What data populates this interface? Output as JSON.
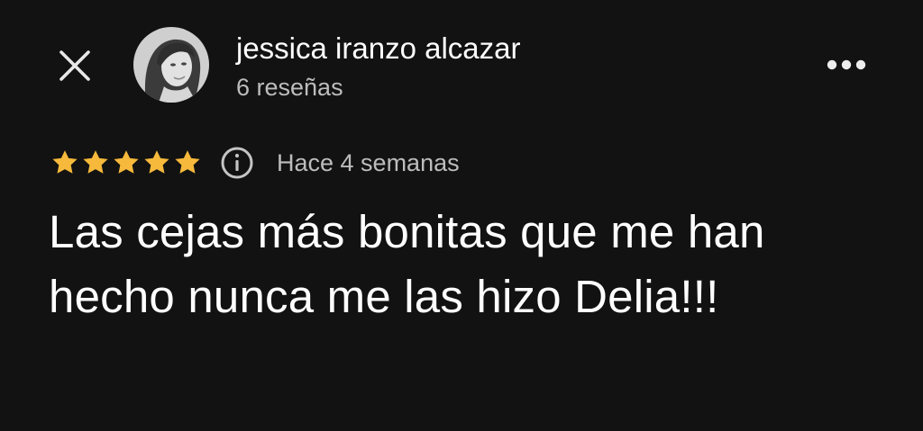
{
  "header": {
    "close_icon": "close-icon",
    "author_name": "jessica iranzo alcazar",
    "review_count": "6 reseñas",
    "more_icon": "more-horizontal-icon"
  },
  "review": {
    "rating": 5,
    "rating_max": 5,
    "star_color": "#F6B93B",
    "info_icon": "info-icon",
    "time_ago": "Hace 4 semanas",
    "text": "Las cejas más bonitas que me han hecho nunca me las hizo Delia!!!"
  },
  "colors": {
    "background": "#121212",
    "primary_text": "#FFFFFF",
    "secondary_text": "#BDBDBD"
  }
}
